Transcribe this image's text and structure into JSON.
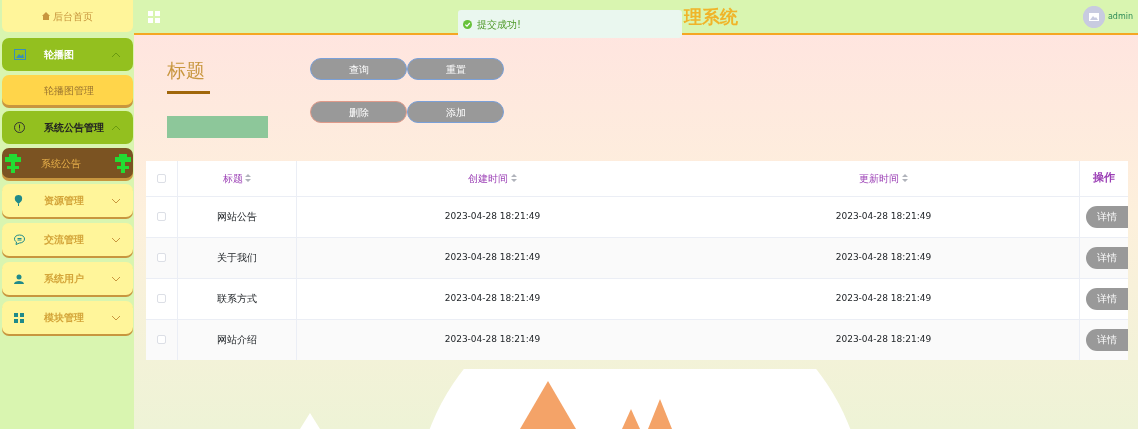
{
  "header": {
    "title": "理系统",
    "user": "admin"
  },
  "toast": {
    "text": "提交成功!"
  },
  "sidebar": {
    "home": "后台首页",
    "menus": [
      {
        "label": "轮播图",
        "expanded": true,
        "children": [
          {
            "label": "轮播图管理",
            "selected": false
          }
        ]
      },
      {
        "label": "系统公告管理",
        "expanded": true,
        "children": [
          {
            "label": "系统公告",
            "selected": true
          }
        ]
      },
      {
        "label": "资源管理",
        "expanded": false
      },
      {
        "label": "交流管理",
        "expanded": false
      },
      {
        "label": "系统用户",
        "expanded": false
      },
      {
        "label": "模块管理",
        "expanded": false
      }
    ]
  },
  "page": {
    "heading": "标题",
    "buttons": [
      "查询",
      "重置",
      "删除",
      "添加"
    ]
  },
  "table": {
    "select_all_checked": false,
    "columns": [
      {
        "label": "标题",
        "sortable": true
      },
      {
        "label": "创建时间",
        "sortable": true
      },
      {
        "label": "更新时间",
        "sortable": true
      },
      {
        "label": "操作",
        "sortable": false
      }
    ],
    "rows": [
      {
        "checked": false,
        "title": "网站公告",
        "created": "2023-04-28 18:21:49",
        "updated": "2023-04-28 18:21:49",
        "action": "详情"
      },
      {
        "checked": false,
        "title": "关于我们",
        "created": "2023-04-28 18:21:49",
        "updated": "2023-04-28 18:21:49",
        "action": "详情"
      },
      {
        "checked": false,
        "title": "联系方式",
        "created": "2023-04-28 18:21:49",
        "updated": "2023-04-28 18:21:49",
        "action": "详情"
      },
      {
        "checked": false,
        "title": "网站介绍",
        "created": "2023-04-28 18:21:49",
        "updated": "2023-04-28 18:21:49",
        "action": "详情"
      }
    ]
  }
}
